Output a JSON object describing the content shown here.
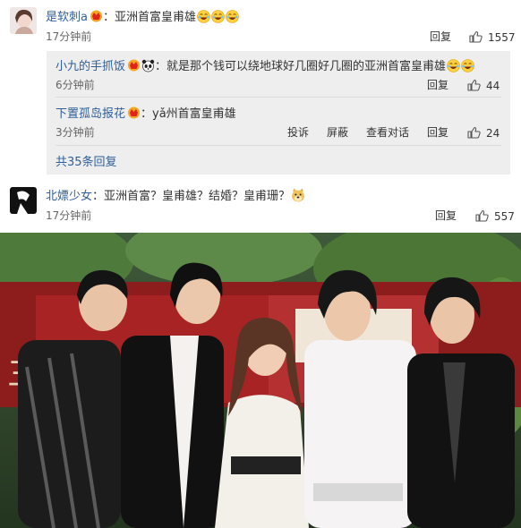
{
  "comment1": {
    "username": "是软刺a",
    "text": "：亚洲首富皇甫雄",
    "time": "17分钟前",
    "reply_label": "回复",
    "likes": "1557"
  },
  "replies": [
    {
      "username": "小九的手抓饭",
      "text": "：就是那个钱可以绕地球好几圈好几圈的亚洲首富皇甫雄",
      "time": "6分钟前",
      "reply_label": "回复",
      "likes": "44"
    },
    {
      "username": "下置孤岛报花",
      "text": "：yǎ州首富皇甫雄",
      "time": "3分钟前",
      "report_label": "投诉",
      "block_label": "屏蔽",
      "view_label": "查看对话",
      "reply_label": "回复",
      "likes": "24"
    }
  ],
  "more_replies": "共35条回复",
  "comment2": {
    "username": "北嫖少女",
    "text": "：亚洲首富？皇甫雄？结婚？皇甫珊？",
    "time": "17分钟前",
    "reply_label": "回复",
    "likes": "557"
  },
  "icons": [
    "vip-badge-icon",
    "laughing-emoji-icon",
    "panda-icon",
    "like-icon",
    "doge-icon"
  ],
  "colors": {
    "link": "#2f5f9a",
    "reply_bg": "#eeeeee",
    "badge": "#f28b0f"
  }
}
